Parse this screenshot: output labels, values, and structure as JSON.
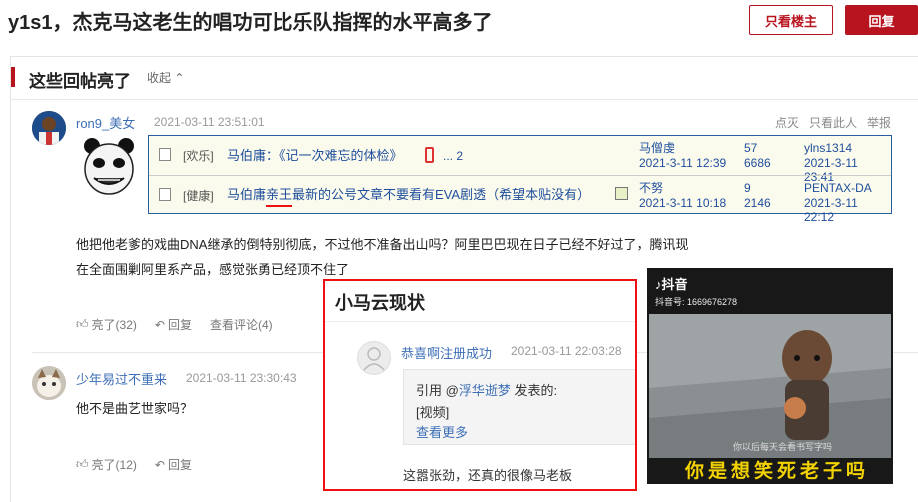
{
  "header": {
    "title": "y1s1，杰克马这老生的唱功可比乐队指挥的水平高多了",
    "owner_only_label": "只看楼主",
    "reply_label": "回复"
  },
  "hot_section": {
    "title": "这些回帖亮了",
    "collapse_label": "收起"
  },
  "posts": [
    {
      "user": "ron9_美女",
      "time": "2021-03-11 23:51:01",
      "meta": [
        "点灭",
        "只看此人",
        "举报"
      ],
      "quote_rows": [
        {
          "category": "[欢乐]",
          "subject": "马伯庸：《记一次难忘的体检》",
          "pages": "... 2",
          "author": "马僧虔",
          "author_date": "2021-3-11 12:39",
          "replies": "57",
          "views": "6686",
          "last_user": "ylns1314",
          "last_date": "2021-3-11 23:41"
        },
        {
          "category": "[健康]",
          "subject_pre": "马伯庸",
          "subject_mark": "亲王",
          "subject_post": "最新的公号文章不要看有EVA剧透（希望本贴没有）",
          "author": "不努",
          "author_date": "2021-3-11 10:18",
          "replies": "9",
          "views": "2146",
          "last_user": "PENTAX-DA",
          "last_date": "2021-3-11 22:12"
        }
      ],
      "content_line1": "他把他老爹的戏曲DNA继承的倒特别彻底，不过他不准备出山吗？阿里巴巴现在日子已经不好过了，腾讯现",
      "content_line2": "在全面围剿阿里系产品，感觉张勇已经顶不住了",
      "likes": "亮了(32)",
      "reply": "回复",
      "view_comments": "查看评论(4)"
    },
    {
      "user": "少年易过不重来",
      "time": "2021-03-11 23:30:43",
      "content": "他不是曲艺世家吗？",
      "likes": "亮了(12)",
      "reply": "回复"
    }
  ],
  "overlay": {
    "title": "小马云现状",
    "user": "恭喜啊注册成功",
    "time": "2021-03-11 22:03:28",
    "quote_prefix": "引用 @",
    "quote_user": "浮华逝梦",
    "quote_suffix": " 发表的:",
    "quote_body": "[视频]",
    "see_more": "查看更多",
    "text": "这嚣张劲，还真的很像马老板"
  },
  "video": {
    "app": "抖音",
    "account": "抖音号: 1669676278",
    "subtitle_small": "你以后每天会看书写字吗",
    "subtitle": "你是想笑死老子吗"
  }
}
